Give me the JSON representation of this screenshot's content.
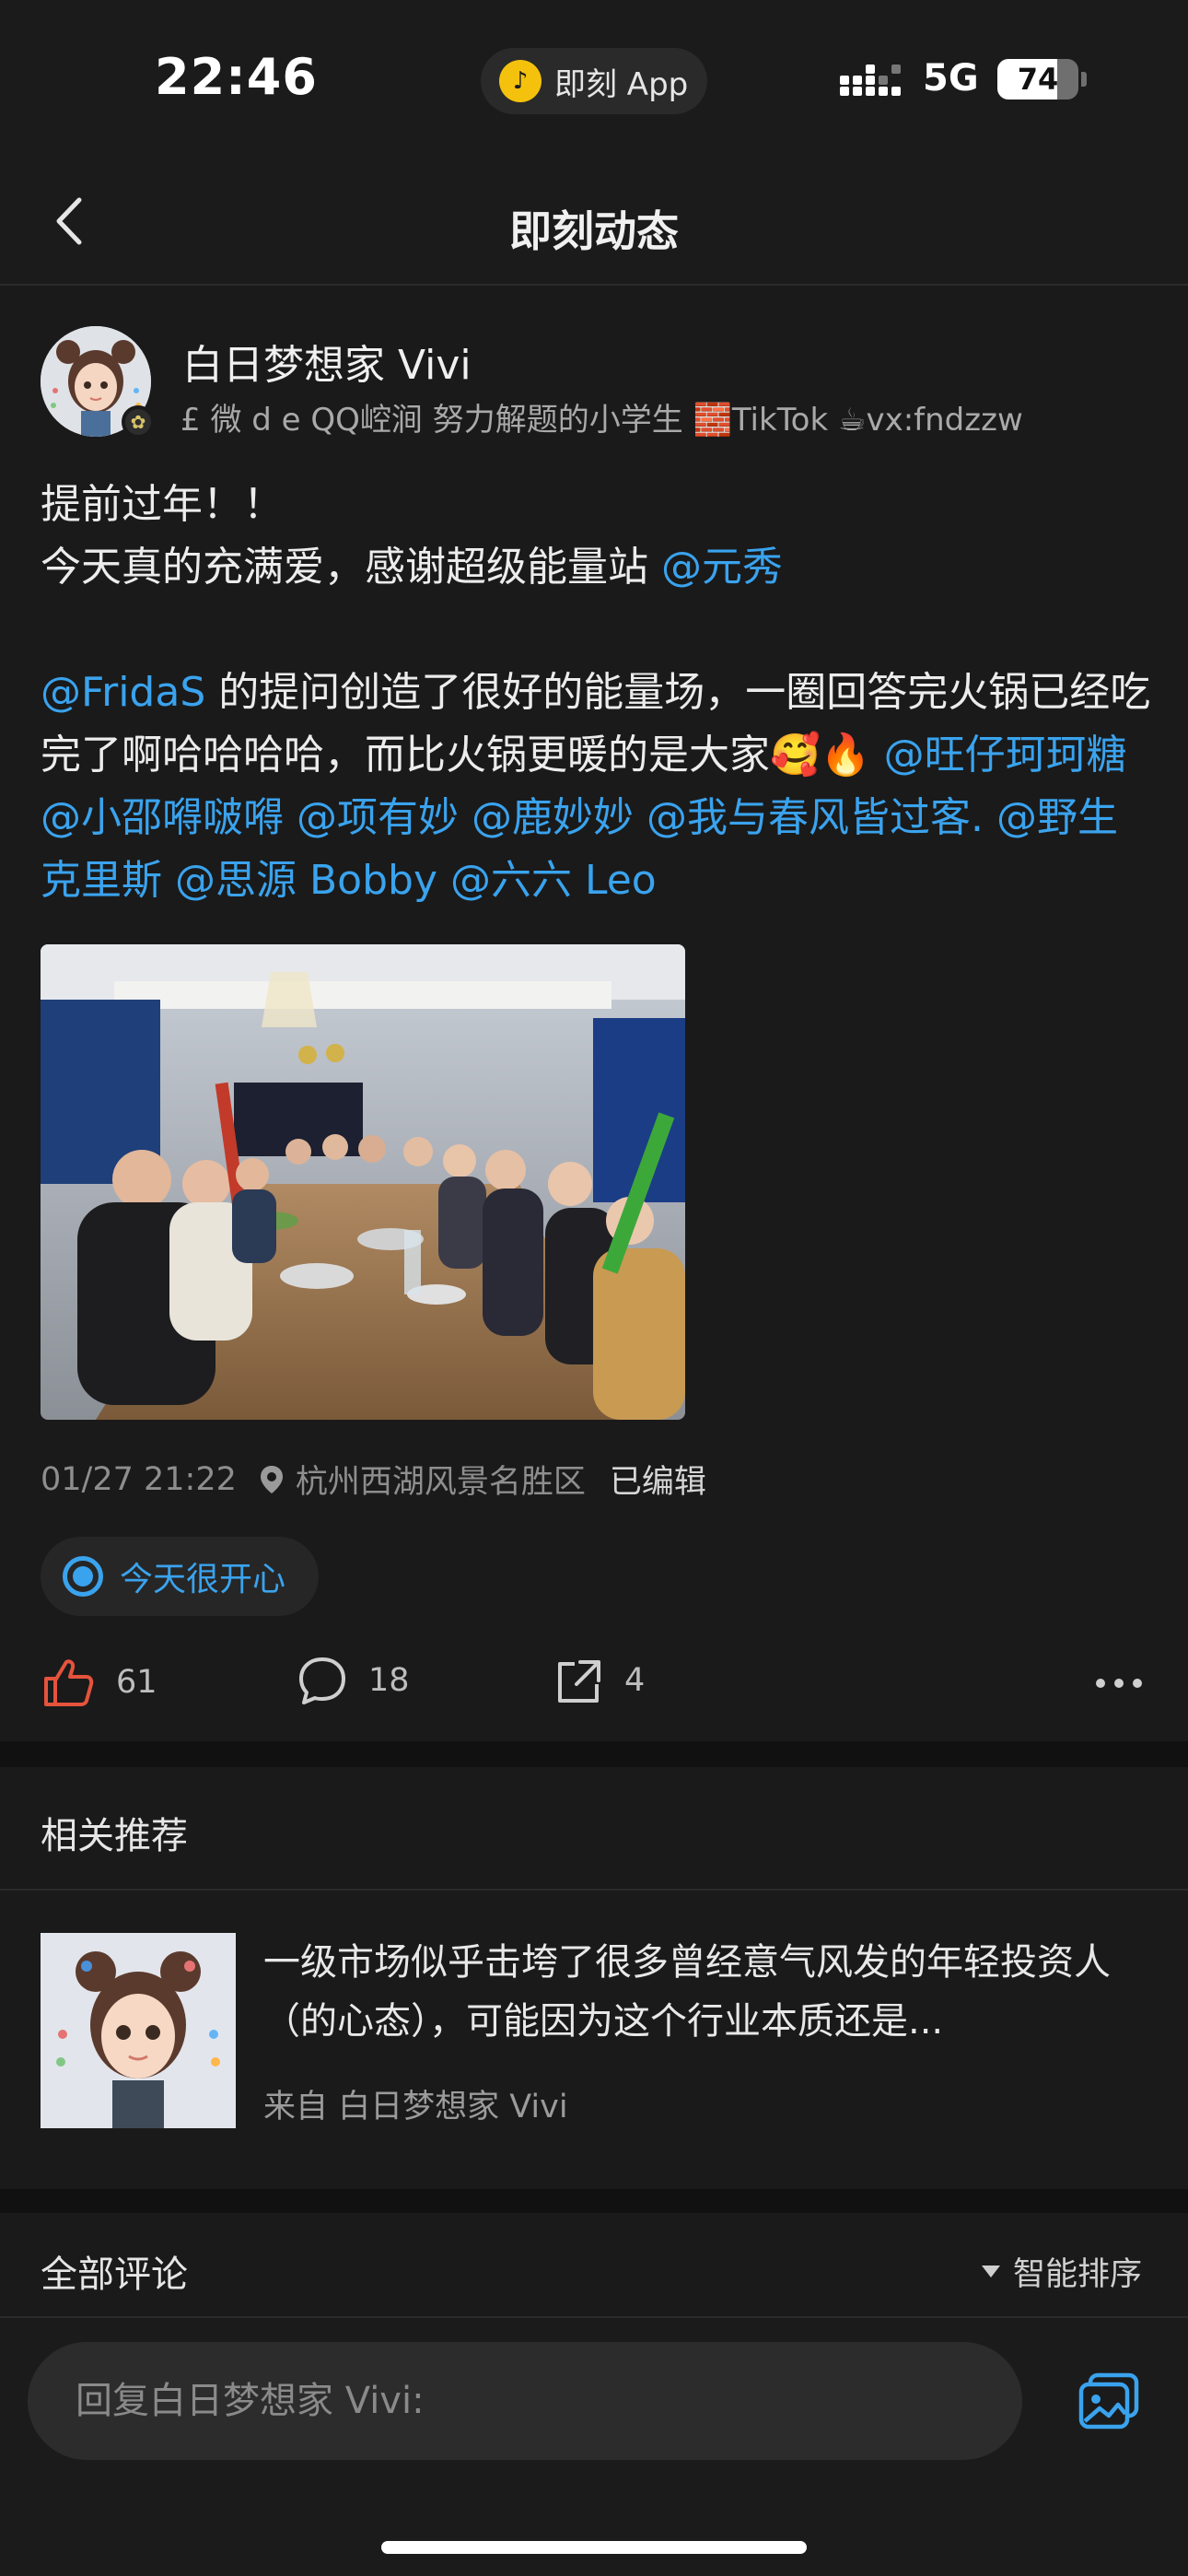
{
  "status_bar": {
    "time": "22:46",
    "island_label": "即刻 App",
    "network": "5G",
    "battery": "74",
    "battery_level": 0.74
  },
  "nav": {
    "title": "即刻动态",
    "back_icon": "chevron-left-icon"
  },
  "post": {
    "author": "白日梦想家 Vivi",
    "bio": "£ 微 d e QQ崆涧   努力解题的小学生   🧱TikTok   ☕vx:fndzzw",
    "content": [
      {
        "text": "提前过年！！\n今天真的充满爱，感谢超级能量站 ",
        "mention": false
      },
      {
        "text": "@元秀",
        "mention": true
      },
      {
        "text": "\n\n",
        "mention": false
      },
      {
        "text": "@FridaS",
        "mention": true
      },
      {
        "text": " 的提问创造了很好的能量场，一圈回答完火锅已经吃完了啊哈哈哈哈，而比火锅更暖的是大家🥰🔥 ",
        "mention": false
      },
      {
        "text": "@旺仔珂珂糖",
        "mention": true
      },
      {
        "text": " ",
        "mention": false
      },
      {
        "text": "@小邵嘚啵嘚",
        "mention": true
      },
      {
        "text": " ",
        "mention": false
      },
      {
        "text": "@项有妙",
        "mention": true
      },
      {
        "text": " ",
        "mention": false
      },
      {
        "text": "@鹿妙妙",
        "mention": true
      },
      {
        "text": " ",
        "mention": false
      },
      {
        "text": "@我与春风皆过客.",
        "mention": true
      },
      {
        "text": " ",
        "mention": false
      },
      {
        "text": "@野生克里斯",
        "mention": true
      },
      {
        "text": " ",
        "mention": false
      },
      {
        "text": "@思源 Bobby",
        "mention": true
      },
      {
        "text": " ",
        "mention": false
      },
      {
        "text": "@六六 Leo",
        "mention": true
      }
    ],
    "timestamp": "01/27 21:22",
    "location": "杭州西湖风景名胜区",
    "edited": "已编辑",
    "mood": "今天很开心",
    "likes": "61",
    "comments": "18",
    "shares": "4"
  },
  "recommendations": {
    "title": "相关推荐",
    "item": {
      "text": "一级市场似乎击垮了很多曾经意气风发的年轻投资人（的心态），可能因为这个行业本质还是...",
      "source": "来自 白日梦想家 Vivi"
    }
  },
  "comments_section": {
    "title": "全部评论",
    "sort_label": "智能排序"
  },
  "reply": {
    "placeholder": "回复白日梦想家 Vivi:"
  },
  "colors": {
    "background": "#1a1a1a",
    "accent": "#3aa3ee",
    "like": "#e5533d",
    "text_primary": "#ececec",
    "text_secondary": "#8e8e8e"
  }
}
